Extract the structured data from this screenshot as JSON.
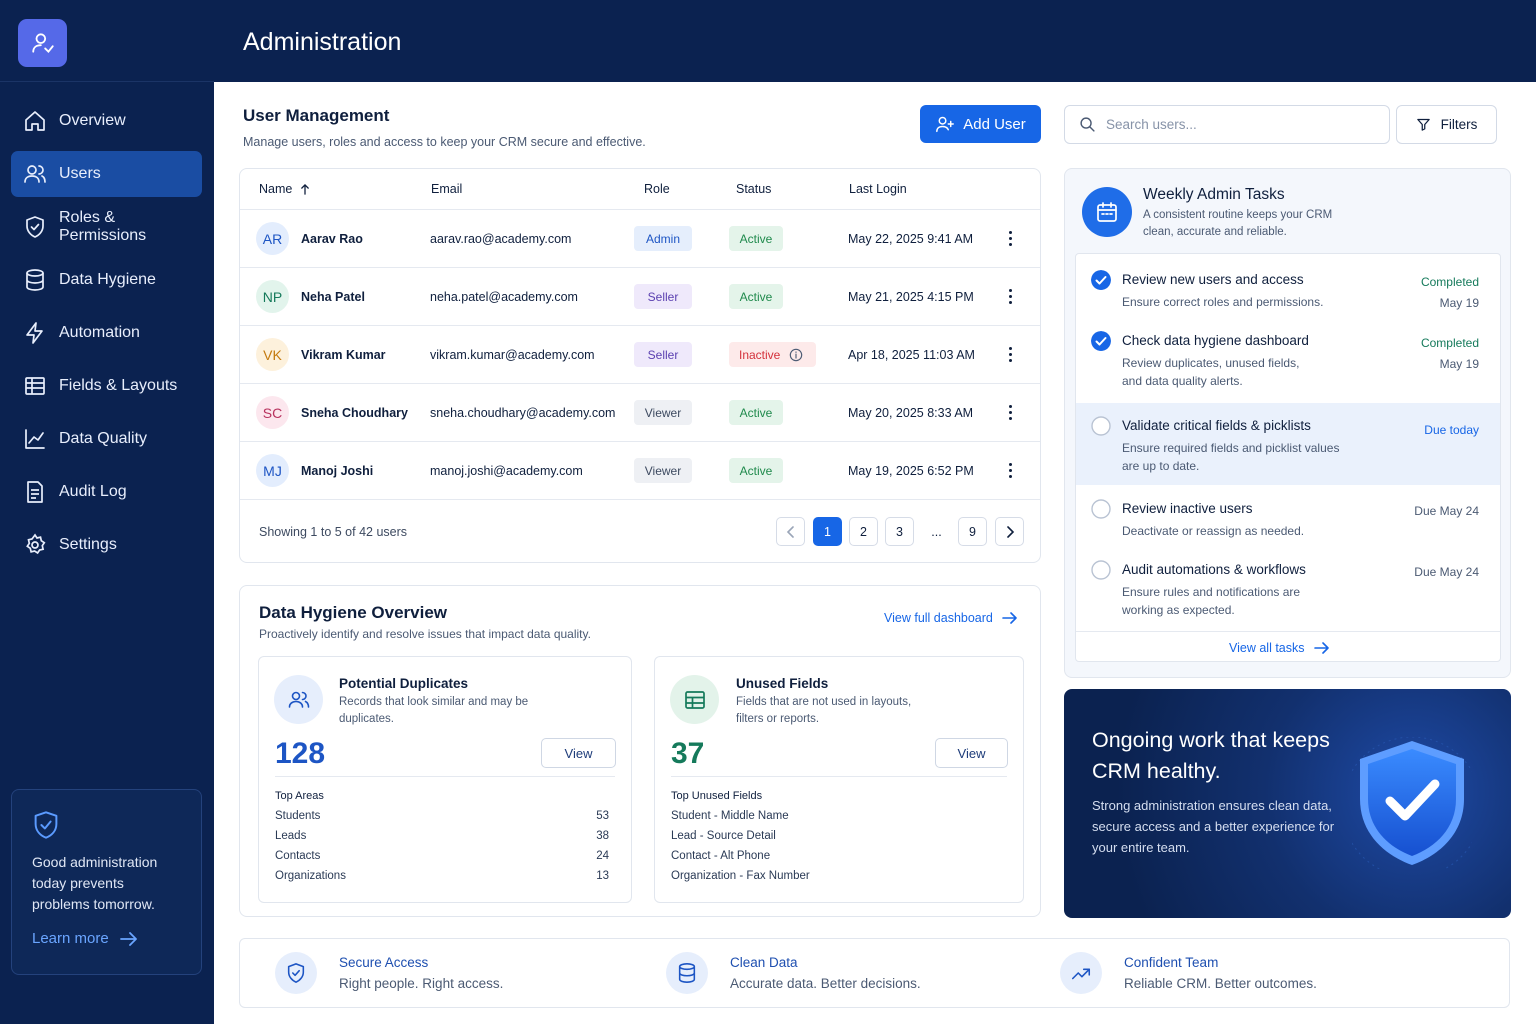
{
  "header": {
    "title": "Administration"
  },
  "sidebar": {
    "items": [
      {
        "label": "Overview",
        "icon": "home-icon"
      },
      {
        "label": "Users",
        "icon": "users-icon",
        "active": true
      },
      {
        "label": "Roles & Permissions",
        "icon": "shield-icon"
      },
      {
        "label": "Data Hygiene",
        "icon": "database-icon"
      },
      {
        "label": "Automation",
        "icon": "lightning-icon"
      },
      {
        "label": "Fields & Layouts",
        "icon": "table-icon"
      },
      {
        "label": "Data Quality",
        "icon": "chart-line-icon"
      },
      {
        "label": "Audit Log",
        "icon": "document-icon"
      },
      {
        "label": "Settings",
        "icon": "gear-icon"
      }
    ],
    "card": {
      "text": "Good administration today prevents problems tomorrow.",
      "link": "Learn more"
    }
  },
  "user_management": {
    "title": "User Management",
    "subtitle": "Manage users, roles and access to keep your CRM secure and effective.",
    "add_user": "Add User",
    "search_placeholder": "Search users...",
    "filters": "Filters",
    "columns": [
      "Name",
      "Email",
      "Role",
      "Status",
      "Last Login"
    ],
    "users": [
      {
        "initials": "AR",
        "name": "Aarav Rao",
        "email": "aarav.rao@academy.com",
        "role": "Admin",
        "status": "Active",
        "last_login": "May 22, 2025 9:41 AM"
      },
      {
        "initials": "NP",
        "name": "Neha Patel",
        "email": "neha.patel@academy.com",
        "role": "Seller",
        "status": "Active",
        "last_login": "May 21, 2025 4:15 PM"
      },
      {
        "initials": "VK",
        "name": "Vikram Kumar",
        "email": "vikram.kumar@academy.com",
        "role": "Seller",
        "status": "Inactive",
        "last_login": "Apr 18, 2025 11:03 AM"
      },
      {
        "initials": "SC",
        "name": "Sneha Choudhary",
        "email": "sneha.choudhary@academy.com",
        "role": "Viewer",
        "status": "Active",
        "last_login": "May 20, 2025 8:33 AM"
      },
      {
        "initials": "MJ",
        "name": "Manoj Joshi",
        "email": "manoj.joshi@academy.com",
        "role": "Viewer",
        "status": "Active",
        "last_login": "May 19, 2025 6:52 PM"
      }
    ],
    "showing": "Showing 1 to 5 of 42 users",
    "pages": [
      "1",
      "2",
      "3",
      "...",
      "9"
    ]
  },
  "data_hygiene": {
    "title": "Data Hygiene Overview",
    "subtitle": "Proactively identify and resolve issues that impact data quality.",
    "link": "View full dashboard",
    "duplicates": {
      "title": "Potential Duplicates",
      "desc": "Records that look similar and may be duplicates.",
      "count": "128",
      "view": "View",
      "list_title": "Top Areas",
      "rows": [
        {
          "label": "Students",
          "value": "53"
        },
        {
          "label": "Leads",
          "value": "38"
        },
        {
          "label": "Contacts",
          "value": "24"
        },
        {
          "label": "Organizations",
          "value": "13"
        }
      ]
    },
    "unused": {
      "title": "Unused Fields",
      "desc": "Fields that are not used in layouts, filters or reports.",
      "count": "37",
      "view": "View",
      "list_title": "Top Unused Fields",
      "rows": [
        {
          "label": "Student - Middle Name"
        },
        {
          "label": "Lead - Source Detail"
        },
        {
          "label": "Contact - Alt Phone"
        },
        {
          "label": "Organization - Fax Number"
        }
      ]
    }
  },
  "weekly_tasks": {
    "title": "Weekly Admin Tasks",
    "subtitle": "A consistent routine keeps your CRM clean, accurate and reliable.",
    "tasks": [
      {
        "title": "Review new users and access",
        "desc": "Ensure correct roles and permissions.",
        "status": "Completed",
        "date": "May 19",
        "done": true
      },
      {
        "title": "Check data hygiene dashboard",
        "desc": "Review duplicates, unused fields, and data quality alerts.",
        "status": "Completed",
        "date": "May 19",
        "done": true
      },
      {
        "title": "Validate critical fields & picklists",
        "desc": "Ensure required fields and picklist values are up to date.",
        "status": "Due today",
        "done": false
      },
      {
        "title": "Review inactive users",
        "desc": "Deactivate or reassign as needed.",
        "status": "Due May 24",
        "done": false
      },
      {
        "title": "Audit automations & workflows",
        "desc": "Ensure rules and notifications are working as expected.",
        "status": "Due May 24",
        "done": false
      }
    ],
    "link": "View all tasks"
  },
  "promo": {
    "title": "Ongoing work that keeps CRM healthy.",
    "text": "Strong administration ensures clean data, secure access and a better experience for your entire team."
  },
  "features": [
    {
      "title": "Secure Access",
      "desc": "Right people. Right access.",
      "icon": "shield-check-icon"
    },
    {
      "title": "Clean Data",
      "desc": "Accurate data. Better decisions.",
      "icon": "database-icon"
    },
    {
      "title": "Confident Team",
      "desc": "Reliable CRM. Better outcomes.",
      "icon": "trend-up-icon"
    }
  ],
  "colors": {
    "navy": "#0b2250",
    "primary": "#1766e6",
    "active_green": "#1f8a4c",
    "inactive_red": "#d4313b",
    "teal": "#157a5b"
  }
}
